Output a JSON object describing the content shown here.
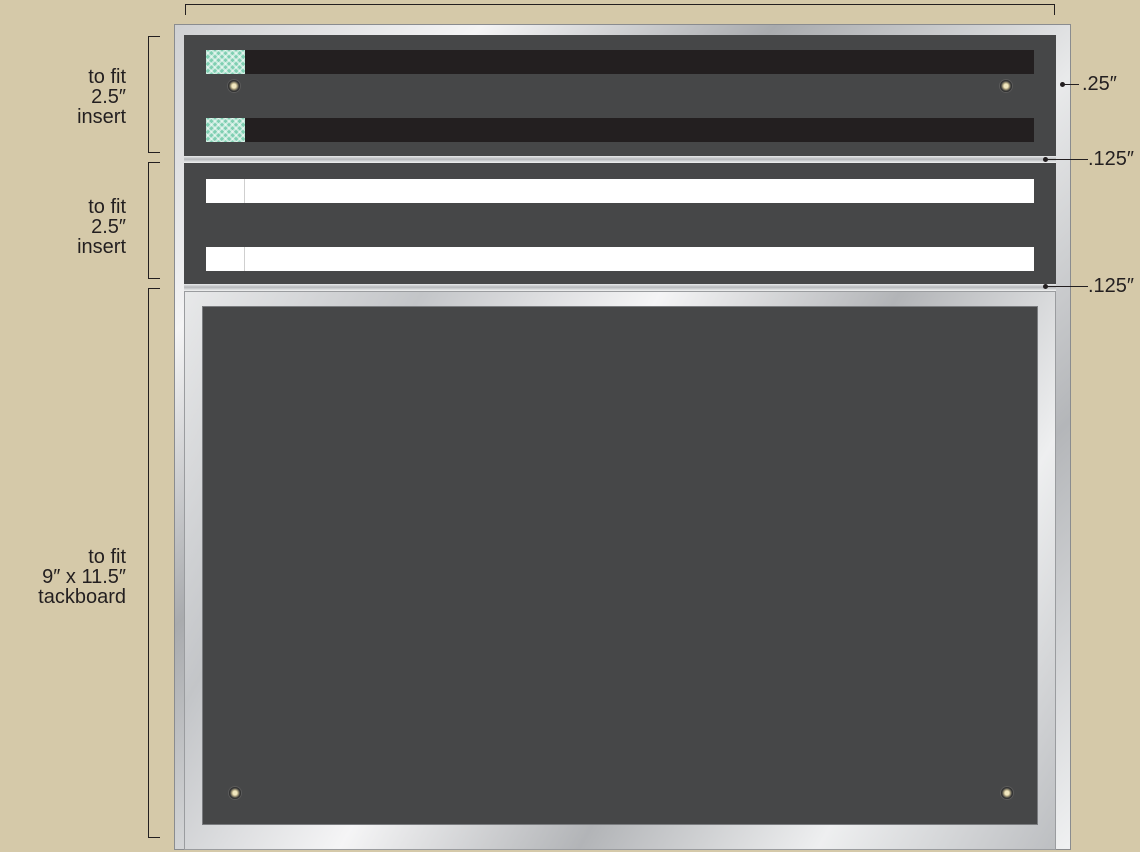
{
  "dimensions": {
    "top_rail": "to fit 2.5″ insert",
    "middle_rail": "to fit 2.5″ insert",
    "tackboard": "to fit 9″ x 11.5″ tackboard",
    "gap_top": ".25″",
    "gap_middle": ".125″",
    "gap_bottom": ".125″"
  },
  "labels": {
    "top": [
      "to fit",
      "2.5″",
      "insert"
    ],
    "middle": [
      "to fit",
      "2.5″",
      "insert"
    ],
    "bottom": [
      "to fit",
      "9″ x 11.5″",
      "tackboard"
    ]
  },
  "colors": {
    "background": "#d5c9a9",
    "panel": "#464748",
    "black_strip": "#231f20",
    "white_strip": "#ffffff",
    "green_tab": "#7fcfb2",
    "frame_metal": "#c3c5c8"
  }
}
